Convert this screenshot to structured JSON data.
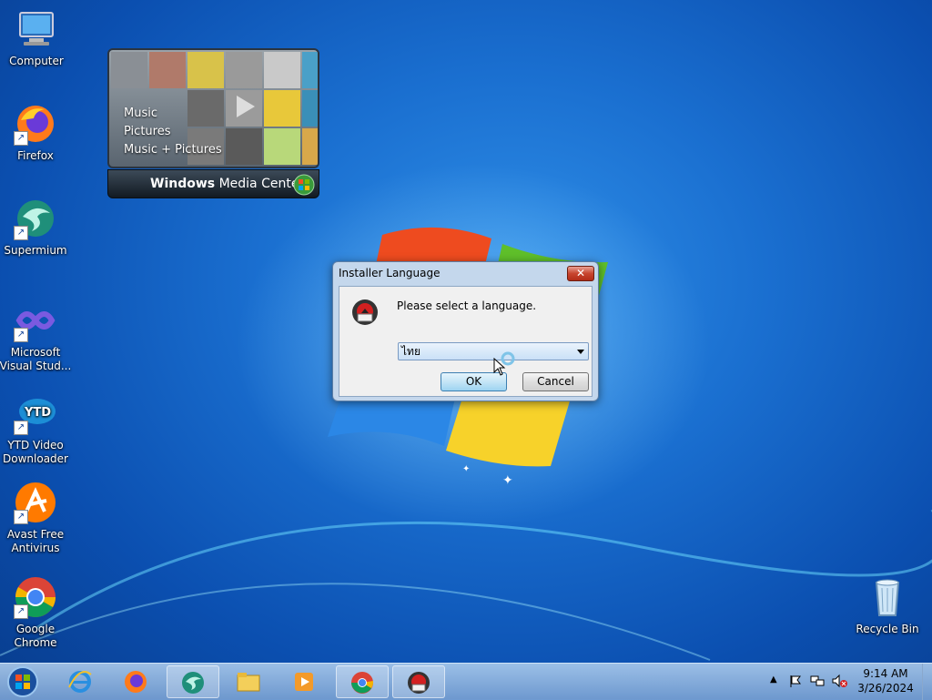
{
  "desktop": {
    "icons": [
      {
        "label": "Computer",
        "shortcut": false
      },
      {
        "label": "Firefox",
        "shortcut": true
      },
      {
        "label": "Supermium",
        "shortcut": true
      },
      {
        "label": "Microsoft Visual Stud...",
        "shortcut": true
      },
      {
        "label": "YTD Video Downloader",
        "shortcut": true
      },
      {
        "label": "Avast Free Antivirus",
        "shortcut": true
      },
      {
        "label": "Google Chrome",
        "shortcut": true
      }
    ],
    "recycle_bin": {
      "label": "Recycle Bin"
    }
  },
  "media_center": {
    "menu": [
      "Music",
      "Pictures",
      "Music + Pictures"
    ],
    "brand_bold": "Windows",
    "brand_rest": " Media Center"
  },
  "dialog": {
    "title": "Installer Language",
    "close_glyph": "✕",
    "message": "Please select a language.",
    "selected_language": "ไทย",
    "ok_label": "OK",
    "cancel_label": "Cancel"
  },
  "taskbar": {
    "items": [
      {
        "name": "internet-explorer",
        "active": false
      },
      {
        "name": "firefox",
        "active": false
      },
      {
        "name": "supermium",
        "active": true
      },
      {
        "name": "file-explorer",
        "active": false
      },
      {
        "name": "media-player",
        "active": false
      },
      {
        "name": "chrome",
        "active": true
      },
      {
        "name": "installer",
        "active": true
      }
    ],
    "clock_time": "9:14 AM",
    "clock_date": "3/26/2024"
  },
  "colors": {
    "desktop_blue": "#1a6fd0",
    "dialog_frame": "#c4d7ec",
    "close_red": "#c8452e"
  }
}
